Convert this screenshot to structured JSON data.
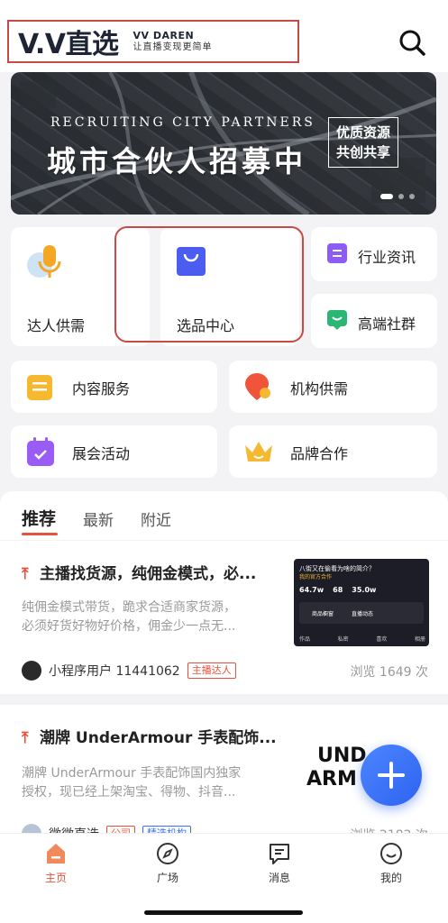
{
  "header": {
    "logo_main": "V.V直选",
    "logo_en": "VV DAREN",
    "logo_cn": "让直播变现更简单"
  },
  "banner": {
    "en_text": "RECRUITING CITY PARTNERS",
    "cn_text": "城市合伙人招募中",
    "tag_line1": "优质资源",
    "tag_line2": "共创共享",
    "slides": 3,
    "active_slide": 1
  },
  "features": {
    "talent": "达人供需",
    "selection": "选品中心",
    "news": "行业资讯",
    "community": "高端社群",
    "content": "内容服务",
    "institution": "机构供需",
    "events": "展会活动",
    "brand": "品牌合作"
  },
  "tabs": {
    "recommend": "推荐",
    "latest": "最新",
    "nearby": "附近"
  },
  "feed": [
    {
      "title": "主播找货源，纯佣金模式，必...",
      "desc_line1": "纯佣金模式带货，跪求合适商家货源，",
      "desc_line2": "必须好货好物好价格，佣金少一点无...",
      "author": "小程序用户 11441062",
      "badge": "主播达人",
      "views": "浏览 1649 次",
      "thumb": {
        "headline": "八街又在偷看为啥的简介？",
        "sub": "我的官方合作",
        "stats": [
          "64.7w",
          "68",
          "35.0w"
        ],
        "buttons": [
          "商品橱窗",
          "直播动态"
        ],
        "tabs": [
          "作品",
          "私密",
          "喜欢",
          "相册"
        ]
      }
    },
    {
      "title": "潮牌 UnderArmour 手表配饰...",
      "desc_line1": "潮牌 UnderArmour 手表配饰国内独家",
      "desc_line2": "授权，现已经上架淘宝、得物、抖音...",
      "author": "微微直选",
      "badge1": "公司",
      "badge2": "精选机构",
      "views": "浏览 2182 次",
      "thumb_text1": "UND",
      "thumb_text2": "ARM"
    }
  ],
  "bottom_nav": {
    "home": "主页",
    "square": "广场",
    "messages": "消息",
    "mine": "我的"
  },
  "colors": {
    "accent": "#e8523a",
    "highlight_border": "#c84a44",
    "fab_blue": "#3a6ff5"
  }
}
